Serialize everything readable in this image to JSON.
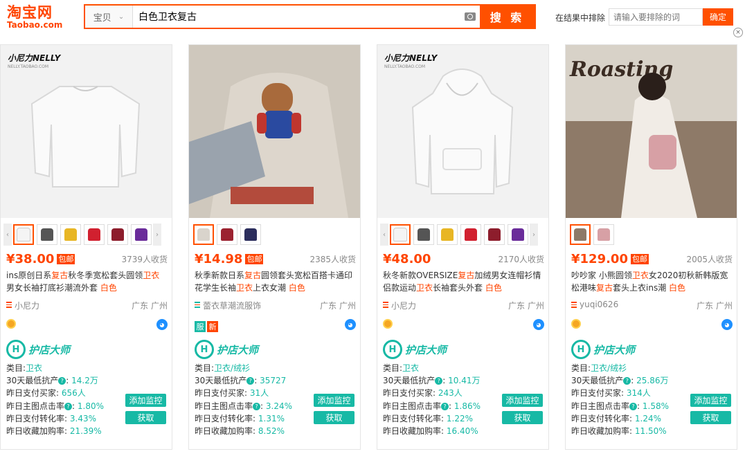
{
  "header": {
    "logo_cn": "淘宝网",
    "logo_en": "Taobao.com",
    "search_scope": "宝贝",
    "search_query": "白色卫衣复古",
    "search_button": "搜 索",
    "exclude_label": "在结果中排除",
    "exclude_placeholder": "请输入要排除的词",
    "exclude_button": "确定",
    "close_glyph": "×"
  },
  "colors": {
    "accent": "#ff5000",
    "price": "#ff4400",
    "tool": "#17b9a5"
  },
  "cards": [
    {
      "brand": "小尼力NELLY",
      "brand_sub": "NELLY.TAOBAO.COM",
      "price": "¥38.00",
      "baoyou": "包邮",
      "sales": "3739人收货",
      "title_parts": [
        "ins原创日系",
        "复古",
        "秋冬季宽松套头圆领",
        "卫衣",
        "男女长袖打底衫潮流外套 ",
        "白色"
      ],
      "shop": "小尼力",
      "location": "广东 广州",
      "tool_name": "护店大师",
      "tool_letter": "H",
      "category_label": "类目:",
      "category": "卫衣",
      "stat_labels": [
        "30天最低抗产",
        "昨日支付买家:",
        "昨日主图点击率",
        "昨日支付转化率:",
        "昨日收藏加购率:"
      ],
      "stat_values": [
        "14.2万",
        "656人",
        "1.80%",
        "3.43%",
        "21.39%"
      ],
      "add_btn": "添加监控",
      "get_btn": "获取"
    },
    {
      "price": "¥14.98",
      "baoyou": "包邮",
      "sales": "2385人收货",
      "title_parts": [
        "秋季新款日系",
        "复古",
        "圆领套头宽松百搭卡通印花学生长袖",
        "卫衣",
        "上衣女潮 ",
        "白色"
      ],
      "shop": "蕾衣草潮流服饰",
      "location": "广东 广州",
      "tags": [
        "服",
        "新"
      ],
      "tool_name": "护店大师",
      "tool_letter": "H",
      "category_label": "类目:",
      "category": "卫衣/绒衫",
      "stat_labels": [
        "30天最低抗产",
        "昨日支付买家:",
        "昨日主图点击率",
        "昨日支付转化率:",
        "昨日收藏加购率:"
      ],
      "stat_values": [
        "35727",
        "31人",
        "3.24%",
        "1.31%",
        "8.52%"
      ],
      "add_btn": "添加监控",
      "get_btn": "获取"
    },
    {
      "brand": "小尼力NELLY",
      "brand_sub": "NELLY.TAOBAO.COM",
      "price": "¥48.00",
      "baoyou": "",
      "sales": "2170人收货",
      "title_parts": [
        "秋冬新款OVERSIZE",
        "复古",
        "加绒男女连帽衫情侣款运动",
        "卫衣",
        "长袖套头外套 ",
        "白色"
      ],
      "shop": "小尼力",
      "location": "广东 广州",
      "tool_name": "护店大师",
      "tool_letter": "H",
      "category_label": "类目:",
      "category": "卫衣",
      "stat_labels": [
        "30天最低抗产",
        "昨日支付买家:",
        "昨日主图点击率",
        "昨日支付转化率:",
        "昨日收藏加购率:"
      ],
      "stat_values": [
        "10.41万",
        "243人",
        "1.86%",
        "1.22%",
        "16.40%"
      ],
      "add_btn": "添加监控",
      "get_btn": "获取"
    },
    {
      "photo_text": "Roasting",
      "price": "¥129.00",
      "baoyou": "包邮",
      "sales": "2005人收货",
      "title_parts": [
        "吵吵家 小熊圆领",
        "卫衣",
        "女2020初秋新韩版宽松港味",
        "复古",
        "套头上衣ins潮 ",
        "白色"
      ],
      "shop": "yuqi0626",
      "location": "广东 广州",
      "tool_name": "护店大师",
      "tool_letter": "H",
      "category_label": "类目:",
      "category": "卫衣/绒衫",
      "stat_labels": [
        "30天最低抗产",
        "昨日支付买家:",
        "昨日主图点击率",
        "昨日支付转化率:",
        "昨日收藏加购率:"
      ],
      "stat_values": [
        "25.86万",
        "314人",
        "1.58%",
        "1.24%",
        "11.50%"
      ],
      "add_btn": "添加监控",
      "get_btn": "获取"
    }
  ]
}
